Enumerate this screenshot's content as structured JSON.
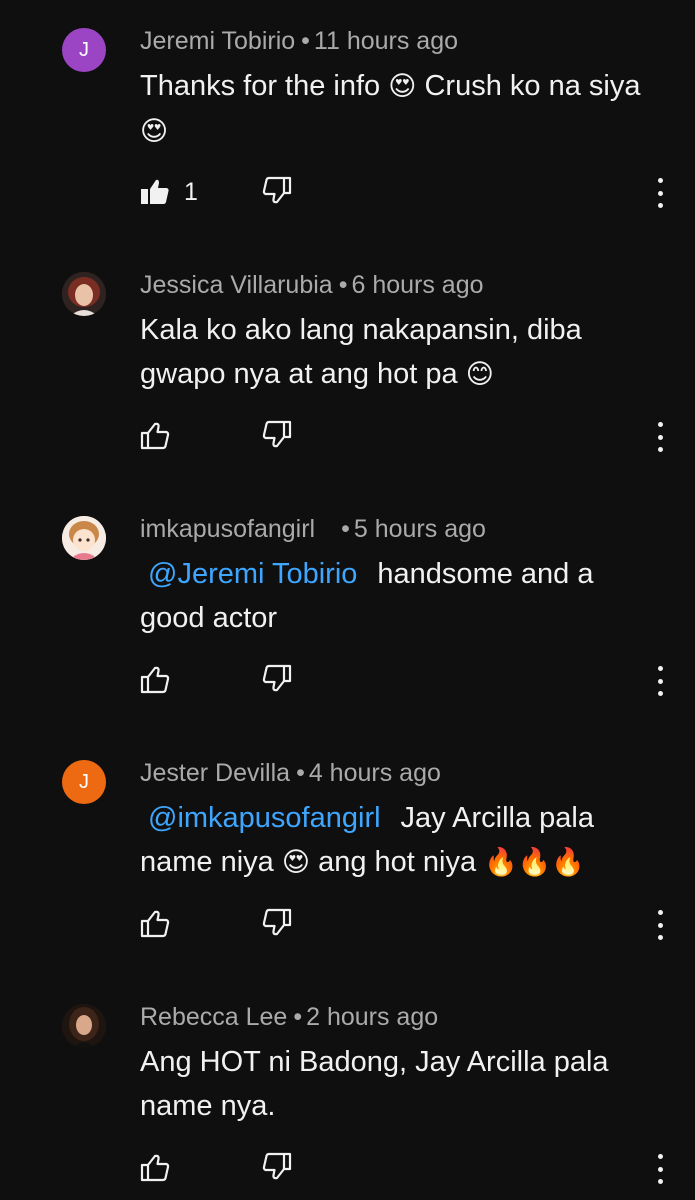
{
  "comments": [
    {
      "author": "Jeremi Tobirio",
      "time": "11 hours ago",
      "avatar_letter": "J",
      "avatar_color": "#9c45c4",
      "text_parts": [
        "Thanks for the info ",
        "😍",
        " Crush ko na siya ",
        "😍"
      ],
      "like_count": "1"
    },
    {
      "author": "Jessica Villarubia",
      "time": "6 hours ago",
      "text_parts": [
        "Kala ko ako lang nakapansin, diba gwapo nya at ang hot pa ",
        "😊"
      ],
      "like_count": ""
    },
    {
      "author": "imkapusofangirl",
      "time": "5 hours ago",
      "mention": "@Jeremi Tobirio",
      "text_parts": [
        "handsome and a good actor"
      ],
      "like_count": ""
    },
    {
      "author": "Jester Devilla",
      "time": "4 hours ago",
      "avatar_letter": "J",
      "avatar_color": "#ee6a12",
      "mention": "@imkapusofangirl",
      "text_parts": [
        "Jay Arcilla pala name niya ",
        "😍",
        " ang hot niya ",
        "🔥🔥🔥"
      ],
      "like_count": ""
    },
    {
      "author": "Rebecca Lee",
      "time": "2 hours ago",
      "text_parts": [
        "Ang HOT ni Badong, Jay Arcilla pala name nya."
      ],
      "like_count": ""
    }
  ],
  "separator": "•",
  "icons": {
    "like": "thumbs-up-icon",
    "dislike": "thumbs-down-icon",
    "more": "more-vertical-icon"
  }
}
